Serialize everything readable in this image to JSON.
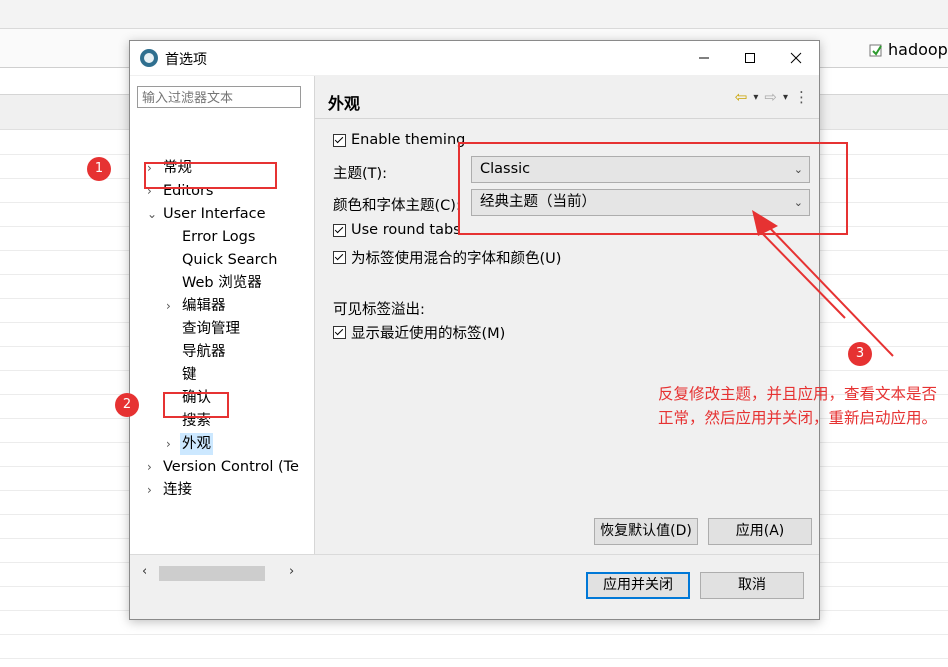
{
  "background": {
    "hadoop_label": "hadoop"
  },
  "dialog": {
    "title": "首选项",
    "minimize_glyph": "—",
    "maximize_glyph": "☐",
    "close_glyph": "✕",
    "filter_placeholder": "输入过滤器文本",
    "tree": [
      {
        "label": "常规",
        "twisty": "›"
      },
      {
        "label": "Editors",
        "twisty": "›"
      },
      {
        "label": "User Interface",
        "twisty": "⌄"
      },
      {
        "label": "Error Logs"
      },
      {
        "label": "Quick Search"
      },
      {
        "label": "Web 浏览器"
      },
      {
        "label": "编辑器",
        "twisty": "›"
      },
      {
        "label": "查询管理"
      },
      {
        "label": "导航器"
      },
      {
        "label": "键"
      },
      {
        "label": "确认"
      },
      {
        "label": "搜索"
      },
      {
        "label": "外观",
        "twisty": "›",
        "selected": true
      },
      {
        "label": "Version Control (Te",
        "twisty": "›"
      },
      {
        "label": "连接",
        "twisty": "›"
      }
    ],
    "scroll": {
      "left_glyph": "‹",
      "right_glyph": "›"
    },
    "page": {
      "title": "外观",
      "nav_back": "⇦",
      "nav_forward": "⇨",
      "nav_menu": "⋮",
      "nav_dropdown": "▾",
      "enable_theming": "Enable theming",
      "theme_label": "主题(T):",
      "theme_value": "Classic",
      "color_font_label": "颜色和字体主题(C):",
      "color_font_value": "经典主题（当前）",
      "use_round_tabs": "Use round tabs",
      "mixed_fonts": "为标签使用混合的字体和颜色(U)",
      "overflow_label": "可见标签溢出:",
      "show_recent": "显示最近使用的标签(M)",
      "combo_arrow": "⌄"
    },
    "buttons": {
      "restore_defaults": "恢复默认值(D)",
      "apply": "应用(A)",
      "apply_and_close": "应用并关闭",
      "cancel": "取消"
    }
  },
  "annotations": {
    "step1": "1",
    "step2": "2",
    "step3": "3",
    "note": "反复修改主题，并且应用，查看文本是否正常，然后应用并关闭，重新启动应用。",
    "color": "#e63232"
  }
}
